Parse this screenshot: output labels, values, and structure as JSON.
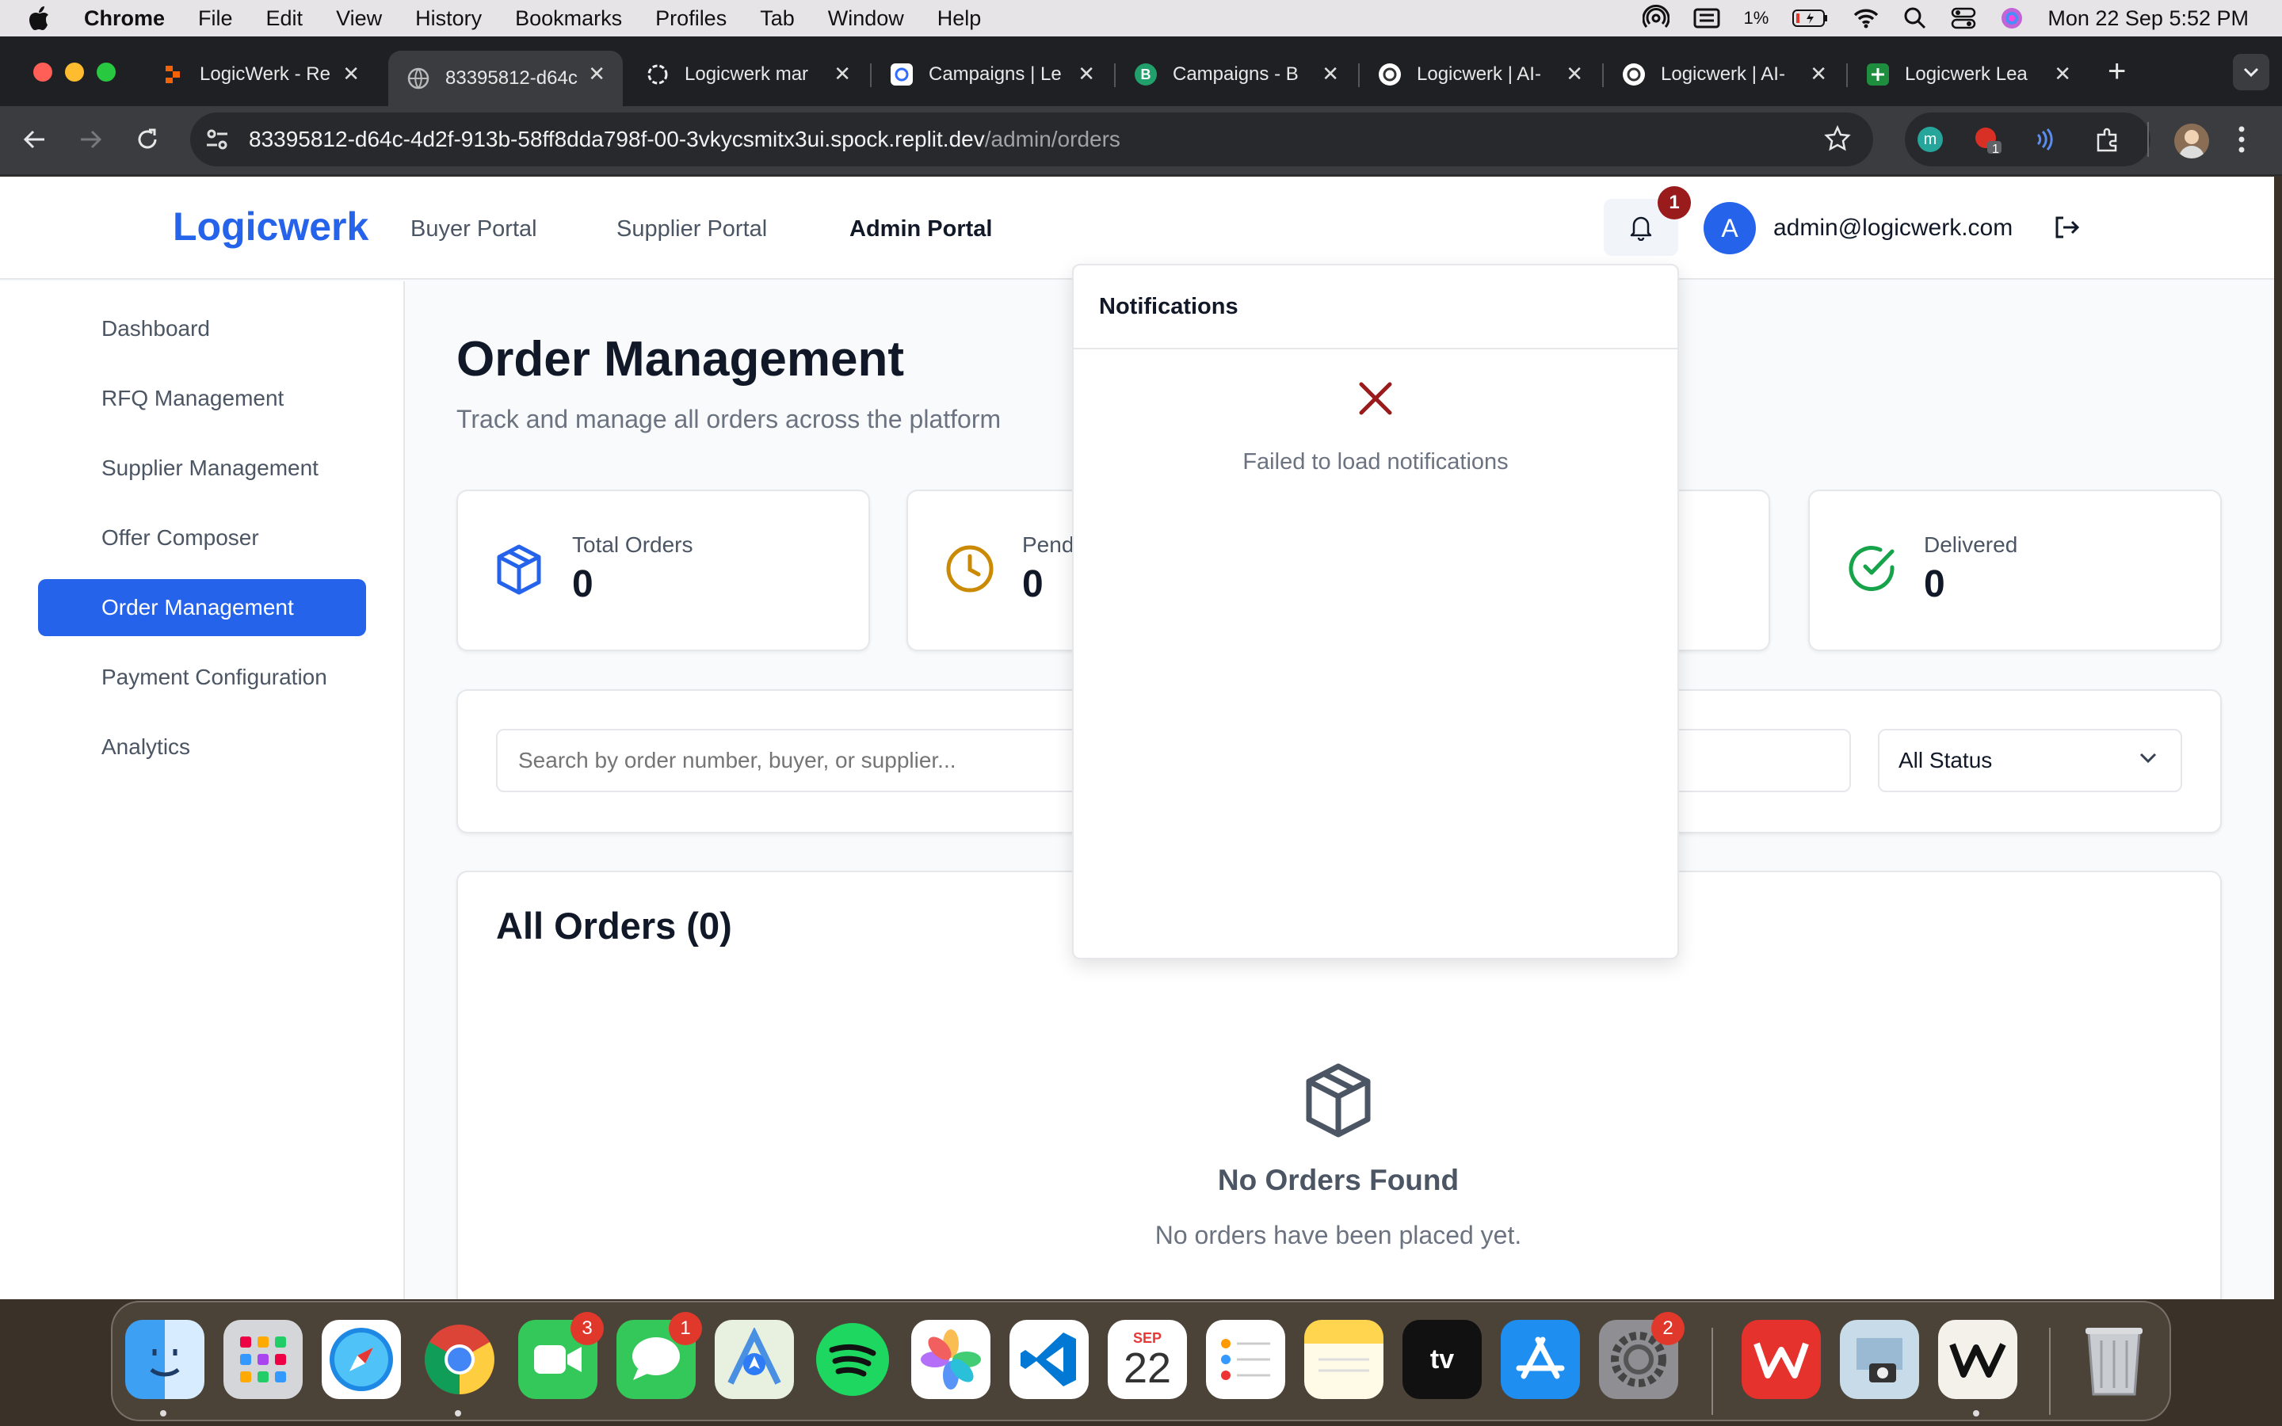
{
  "menubar": {
    "app": "Chrome",
    "items": [
      "File",
      "Edit",
      "View",
      "History",
      "Bookmarks",
      "Profiles",
      "Tab",
      "Window",
      "Help"
    ],
    "battery": "1%",
    "datetime": "Mon 22 Sep  5:52 PM"
  },
  "tabs": [
    {
      "title": "LogicWerk - Re",
      "favicon": "replit-icon",
      "color": "#f26207"
    },
    {
      "title": "83395812-d64c",
      "favicon": "globe-icon",
      "color": "#9aa0a6",
      "active": true
    },
    {
      "title": "Logicwerk mar",
      "favicon": "openai-icon",
      "color": "#e8e8e8"
    },
    {
      "title": "Campaigns | Le",
      "favicon": "lemlist-icon",
      "color": "#ffffff"
    },
    {
      "title": "Campaigns - B",
      "favicon": "b-icon",
      "color": "#22a06b"
    },
    {
      "title": "Logicwerk | AI-",
      "favicon": "logicwerk-icon",
      "color": "#ffffff"
    },
    {
      "title": "Logicwerk | AI-",
      "favicon": "logicwerk-icon",
      "color": "#ffffff"
    },
    {
      "title": "Logicwerk Lea",
      "favicon": "sheets-icon",
      "color": "#1e8e3e"
    }
  ],
  "url": {
    "host": "83395812-d64c-4d2f-913b-58ff8dda798f-00-3vkycsmitx3ui.spock.replit.dev",
    "path": "/admin/orders"
  },
  "extensions": {
    "badge": "1"
  },
  "header": {
    "logo": "Logicwerk",
    "nav": [
      "Buyer Portal",
      "Supplier Portal",
      "Admin Portal"
    ],
    "notification_count": "1",
    "avatar_letter": "A",
    "email": "admin@logicwerk.com"
  },
  "sidebar": {
    "items": [
      "Dashboard",
      "RFQ Management",
      "Supplier Management",
      "Offer Composer",
      "Order Management",
      "Payment Configuration",
      "Analytics"
    ],
    "active": "Order Management"
  },
  "main": {
    "title": "Order Management",
    "subtitle": "Track and manage all orders across the platform",
    "stats": [
      {
        "label": "Total Orders",
        "value": "0",
        "icon": "package-icon",
        "color": "#2563eb"
      },
      {
        "label": "Pending",
        "value": "0",
        "icon": "clock-icon",
        "color": "#ca8a04"
      },
      {
        "label": "Delivered",
        "value": "0",
        "icon": "check-circle-icon",
        "color": "#16a34a"
      }
    ],
    "search_placeholder": "Search by order number, buyer, or supplier...",
    "status_filter": "All Status",
    "orders_title": "All Orders (0)",
    "empty_title": "No Orders Found",
    "empty_text": "No orders have been placed yet."
  },
  "notifications": {
    "title": "Notifications",
    "error": "Failed to load notifications",
    "error_color": "#991b1b"
  },
  "dock": {
    "apps": [
      "finder",
      "launchpad",
      "safari",
      "chrome",
      "facetime",
      "messages",
      "maps",
      "spotify",
      "photos",
      "vscode",
      "calendar",
      "reminders",
      "notes",
      "apple-tv",
      "app-store",
      "system-settings",
      "wps",
      "preview",
      "writer",
      "trash"
    ],
    "badges": {
      "facetime": "3",
      "messages": "1",
      "system-settings": "2"
    },
    "calendar": {
      "month": "SEP",
      "day": "22"
    }
  }
}
